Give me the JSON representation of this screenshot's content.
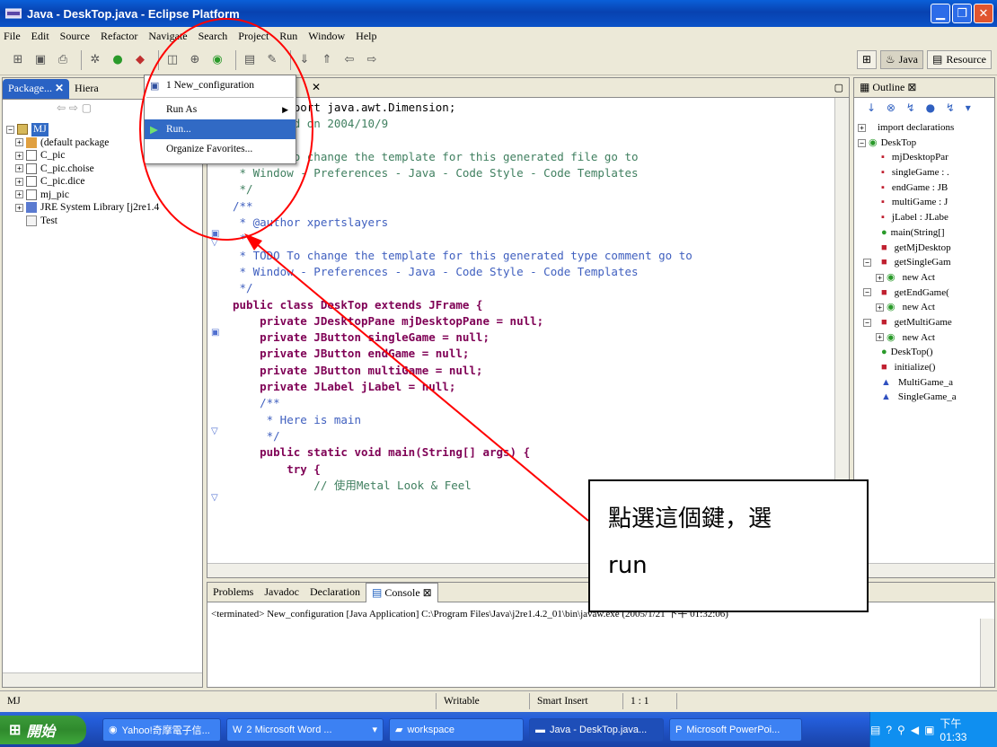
{
  "window": {
    "title": "Java - DeskTop.java - Eclipse Platform"
  },
  "menubar": [
    "File",
    "Edit",
    "Source",
    "Refactor",
    "Navigate",
    "Search",
    "Project",
    "Run",
    "Window",
    "Help"
  ],
  "perspectives": {
    "java": "Java",
    "resource": "Resource"
  },
  "left_panel": {
    "tab_package": "Package...",
    "tab_hierarchy": "Hiera",
    "tree": [
      "MJ",
      "(default package",
      "C_pic",
      "C_pic.choise",
      "C_pic.dice",
      "mj_pic",
      "JRE System Library [j2re1.4",
      "Test"
    ]
  },
  "run_menu": {
    "item1": "1 New_configuration",
    "item2": "Run As",
    "item3": "Run...",
    "item4": "Organize Favorites..."
  },
  "editor": {
    "lines": [
      "import java.awt.Dimension;",
      "",
      "/* Created on 2004/10/9",
      " *",
      " * TODO To change the template for this generated file go to",
      " * Window - Preferences - Java - Code Style - Code Templates",
      " */",
      "",
      "/**",
      " * @author xpertslayers",
      " *",
      " * TODO To change the template for this generated type comment go to",
      " * Window - Preferences - Java - Code Style - Code Templates",
      " */",
      "public class DeskTop extends JFrame {",
      "",
      "    private JDesktopPane mjDesktopPane = null;",
      "    private JButton singleGame = null;",
      "    private JButton endGame = null;",
      "    private JButton multiGame = null;",
      "    private JLabel jLabel = null;",
      "    /**",
      "     * Here is main",
      "     */",
      "    public static void main(String[] args) {",
      "        try {",
      "            // 使用Metal Look & Feel"
    ]
  },
  "outline": {
    "tab": "Outline",
    "items": [
      "import declarations",
      "DeskTop",
      "mjDesktopPar",
      "singleGame : .",
      "endGame : JB",
      "multiGame : J",
      "jLabel : JLabe",
      "main(String[]",
      "getMjDesktop",
      "getSingleGam",
      "new Act",
      "getEndGame(",
      "new Act",
      "getMultiGame",
      "new Act",
      "DeskTop()",
      "initialize()",
      "MultiGame_a",
      "SingleGame_a"
    ]
  },
  "bottom_panel": {
    "tabs": [
      "Problems",
      "Javadoc",
      "Declaration",
      "Console"
    ],
    "console_line": "<terminated> New_configuration [Java Application] C:\\Program Files\\Java\\j2re1.4.2_01\\bin\\javaw.exe (2005/1/21 下午 01:32:06)"
  },
  "callout": {
    "line1": "點選這個鍵，選",
    "line2": "run"
  },
  "statusbar": {
    "project": "MJ",
    "writable": "Writable",
    "insert": "Smart Insert",
    "position": "1 : 1"
  },
  "taskbar": {
    "start": "開始",
    "tasks": [
      "Yahoo!奇摩電子信...",
      "2 Microsoft Word ...",
      "workspace",
      "Java - DeskTop.java...",
      "Microsoft PowerPoi..."
    ],
    "clock": "下午 01:33"
  },
  "colors": {
    "annotation_red": "#ff0000",
    "selection_blue": "#316ac5",
    "keyword": "#7f0055",
    "comment": "#3f7f5f"
  }
}
